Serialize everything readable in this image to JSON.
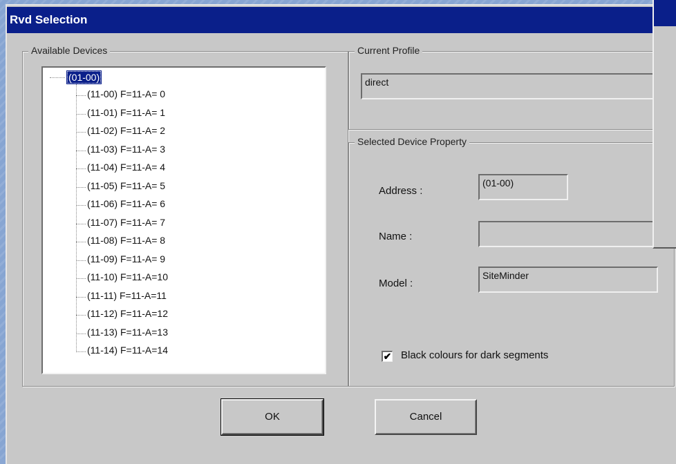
{
  "window": {
    "title": "Rvd Selection"
  },
  "available_devices": {
    "label": "Available Devices",
    "root": "(01-00)",
    "items": [
      "(11-00) F=11-A= 0",
      "(11-01) F=11-A= 1",
      "(11-02) F=11-A= 2",
      "(11-03) F=11-A= 3",
      "(11-04) F=11-A= 4",
      "(11-05) F=11-A= 5",
      "(11-06) F=11-A= 6",
      "(11-07) F=11-A= 7",
      "(11-08) F=11-A= 8",
      "(11-09) F=11-A= 9",
      "(11-10) F=11-A=10",
      "(11-11) F=11-A=11",
      "(11-12) F=11-A=12",
      "(11-13) F=11-A=13",
      "(11-14) F=11-A=14"
    ]
  },
  "current_profile": {
    "label": "Current Profile",
    "value": "direct"
  },
  "device_property": {
    "label": "Selected Device Property",
    "address_label": "Address :",
    "address_value": "(01-00)",
    "name_label": "Name :",
    "name_value": "",
    "model_label": "Model :",
    "model_value": "SiteMinder",
    "checkbox_label": "Black colours for dark segments",
    "checkbox_checked": true,
    "checkbox_mark": "✔"
  },
  "buttons": {
    "ok": "OK",
    "cancel": "Cancel"
  },
  "colors": {
    "titlebar": "#0a1f8a",
    "dialog_bg": "#c8c8c8",
    "desktop_bg": "#87a5d2"
  }
}
